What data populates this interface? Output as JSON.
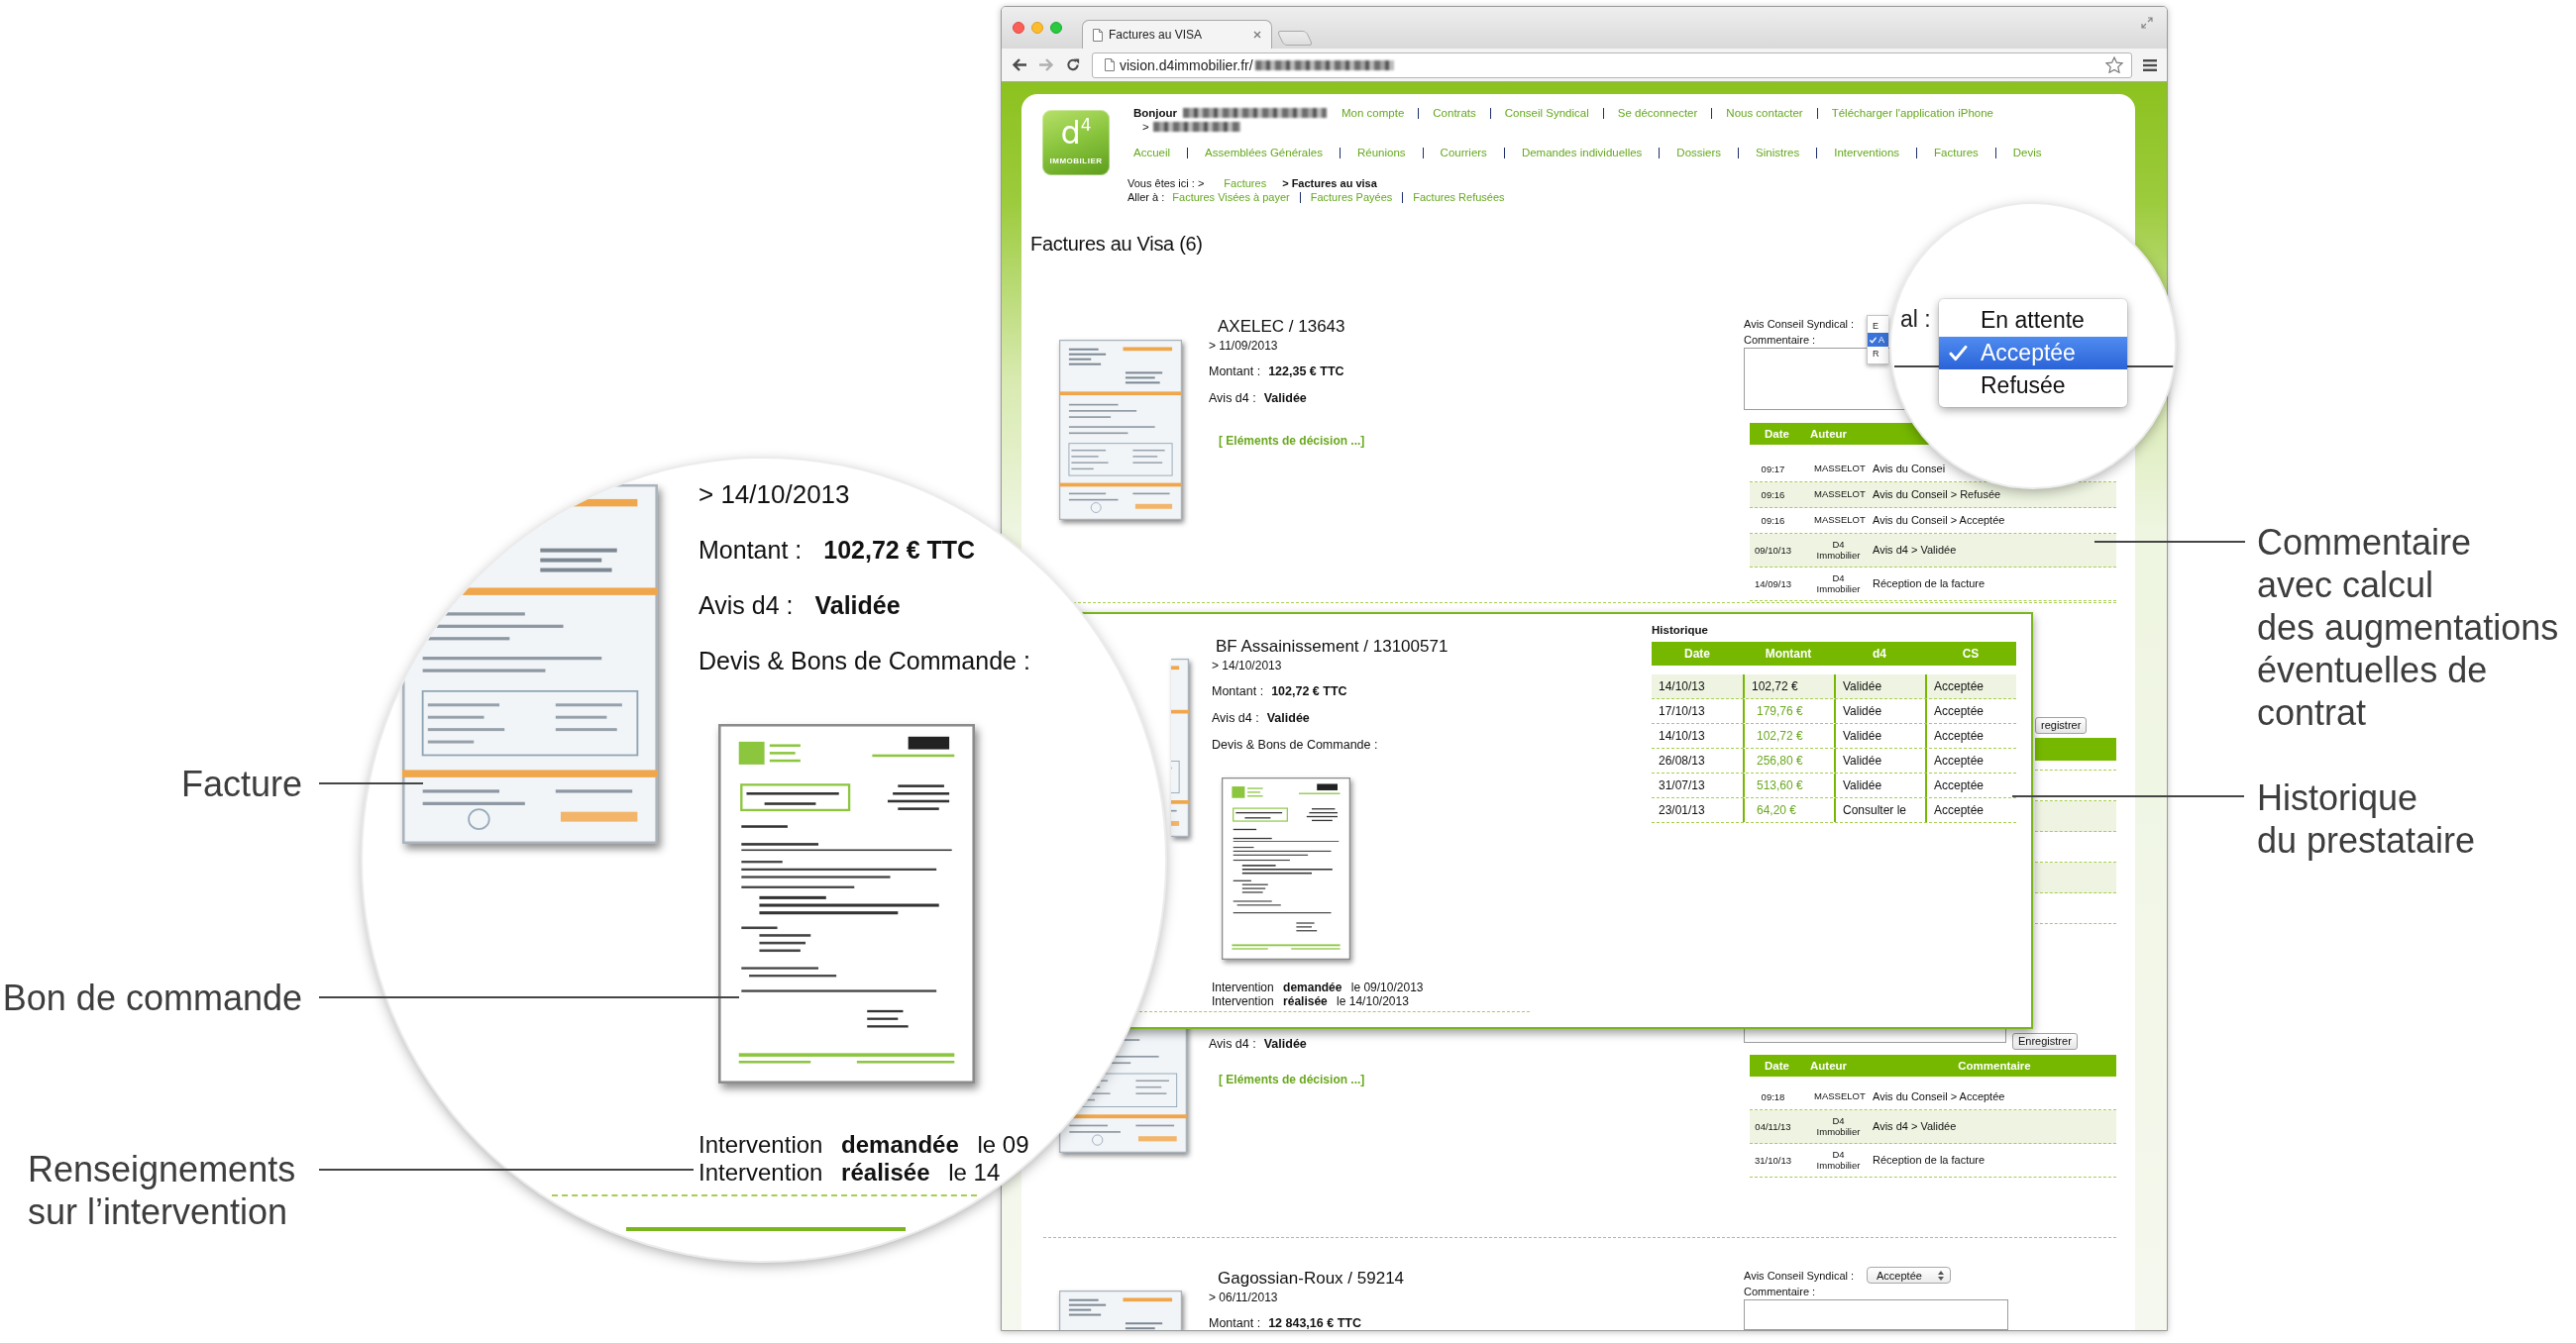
{
  "browser": {
    "tab_title": "Factures au VISA",
    "url": "vision.d4immobilier.fr/"
  },
  "header": {
    "logo": {
      "mark": "d$^{4}$",
      "subtitle": "IMMOBILIER"
    },
    "greeting": "Bonjour",
    "greeting_marker": ">",
    "account_links": [
      "Mon compte",
      "Contrats",
      "Conseil Syndical",
      "Se déconnecter",
      "Nous contacter",
      "Télécharger l'application iPhone"
    ],
    "main_nav": [
      "Accueil",
      "Assemblées Générales",
      "Réunions",
      "Courriers",
      "Demandes individuelles",
      "Dossiers",
      "Sinistres",
      "Interventions",
      "Factures",
      "Devis"
    ],
    "breadcrumb": {
      "label": "Vous êtes ici : >",
      "link": "Factures",
      "current": "> Factures au visa"
    },
    "goto": {
      "label": "Aller à :",
      "links": [
        "Factures Visées à payer",
        "Factures Payées",
        "Factures Refusées"
      ]
    }
  },
  "page_title": "Factures au Visa (6)",
  "invoices": [
    {
      "kind": "collapsed",
      "title": "AXELEC / 13643",
      "date": "> 11/09/2013",
      "amount_label": "Montant :",
      "amount": "122,35 € TTC",
      "review_label": "Avis d4 :",
      "review_status": "Validée",
      "decision_link": "[ Eléments de décision ...]",
      "council_label": "Avis Conseil Syndical :",
      "council_options": [
        {
          "label": "E",
          "selected": false
        },
        {
          "label": "A",
          "selected": true
        },
        {
          "label": "R",
          "selected": false
        }
      ],
      "comment_label": "Commentaire :",
      "log": {
        "columns": [
          "Date",
          "Auteur"
        ],
        "rows": [
          {
            "time": "09:17",
            "author": "MASSELOT",
            "comment": "Avis du Consei"
          },
          {
            "time": "09:16",
            "author": "MASSELOT",
            "comment": "Avis du Conseil > Refusée"
          },
          {
            "time": "09:16",
            "author": "MASSELOT",
            "comment": "Avis du Conseil > Acceptée"
          },
          {
            "time": "09/10/13",
            "author": "D4 Immobilier",
            "comment": "Avis d4 > Validée"
          },
          {
            "time": "14/09/13",
            "author": "D4 Immobilier",
            "comment": "Réception de la facture"
          }
        ]
      }
    },
    {
      "kind": "covered",
      "save_button": "registrer"
    },
    {
      "kind": "partly_covered",
      "review_label": "Avis d4 :",
      "review_status": "Validée",
      "decision_link": "[ Eléments de décision ...]",
      "save_button": "Enregistrer",
      "log": {
        "columns": [
          "Date",
          "Auteur",
          "Commentaire"
        ],
        "rows": [
          {
            "time": "09:18",
            "author": "MASSELOT",
            "comment": "Avis du Conseil > Acceptée"
          },
          {
            "time": "04/11/13",
            "author": "D4 Immobilier",
            "comment": "Avis d4 > Validée"
          },
          {
            "time": "31/10/13",
            "author": "D4 Immobilier",
            "comment": "Réception de la facture"
          }
        ]
      }
    },
    {
      "kind": "cut_off",
      "title": "Gagossian-Roux / 59214",
      "date": "> 06/11/2013",
      "amount_label": "Montant :",
      "amount": "12 843,16 € TTC",
      "council_label": "Avis Conseil Syndical :",
      "council_value": "Acceptée",
      "comment_label": "Commentaire :"
    }
  ],
  "expanded_invoice": {
    "title": "BF Assainissement / 13100571",
    "date": "> 14/10/2013",
    "amount_label": "Montant :",
    "amount": "102,72 € TTC",
    "review_label": "Avis d4 :",
    "review_status": "Validée",
    "documents_label": "Devis & Bons de Commande :",
    "interventions": [
      "Intervention **demandée** le 09/10/2013",
      "Intervention **réalisée** le 14/10/2013"
    ],
    "history": {
      "title": "Historique",
      "columns": [
        "Date",
        "Montant",
        "d4",
        "CS"
      ],
      "rows": [
        {
          "date": "14/10/13",
          "amount": "102,72 €",
          "d4": "Validée",
          "cs": "Acceptée",
          "current": true
        },
        {
          "date": "17/10/13",
          "amount": "179,76 €",
          "d4": "Validée",
          "cs": "Acceptée",
          "current": false
        },
        {
          "date": "14/10/13",
          "amount": "102,72 €",
          "d4": "Validée",
          "cs": "Acceptée",
          "current": false
        },
        {
          "date": "26/08/13",
          "amount": "256,80 €",
          "d4": "Validée",
          "cs": "Acceptée",
          "current": false
        },
        {
          "date": "31/07/13",
          "amount": "513,60 €",
          "d4": "Validée",
          "cs": "Acceptée",
          "current": false
        },
        {
          "date": "23/01/13",
          "amount": "64,20 €",
          "d4": "Consulter le",
          "cs": "Acceptée",
          "current": false
        }
      ]
    }
  },
  "lens_dropdown": {
    "label_fragment": "al :",
    "options": [
      {
        "label": "En attente",
        "selected": false
      },
      {
        "label": "Acceptée",
        "selected": true
      },
      {
        "label": "Refusée",
        "selected": false
      }
    ]
  },
  "lens_detail": {
    "date": "> 14/10/2013",
    "amount_label": "Montant :",
    "amount": "102,72 € TTC",
    "review_label": "Avis d4 :",
    "review_status": "Validée",
    "documents_label": "Devis & Bons de Commande :",
    "interventions": [
      "Intervention **demandée** le 09",
      "Intervention **réalisée** le 14"
    ]
  },
  "annotations": [
    {
      "text": "Facture"
    },
    {
      "text": "Bon de commande"
    },
    {
      "text": "Renseignements\nsur l’intervention"
    },
    {
      "text": "Commentaire\navec calcul\ndes augmentations\néventuelles de\ncontrat"
    },
    {
      "text": "Historique\ndu prestataire"
    }
  ]
}
